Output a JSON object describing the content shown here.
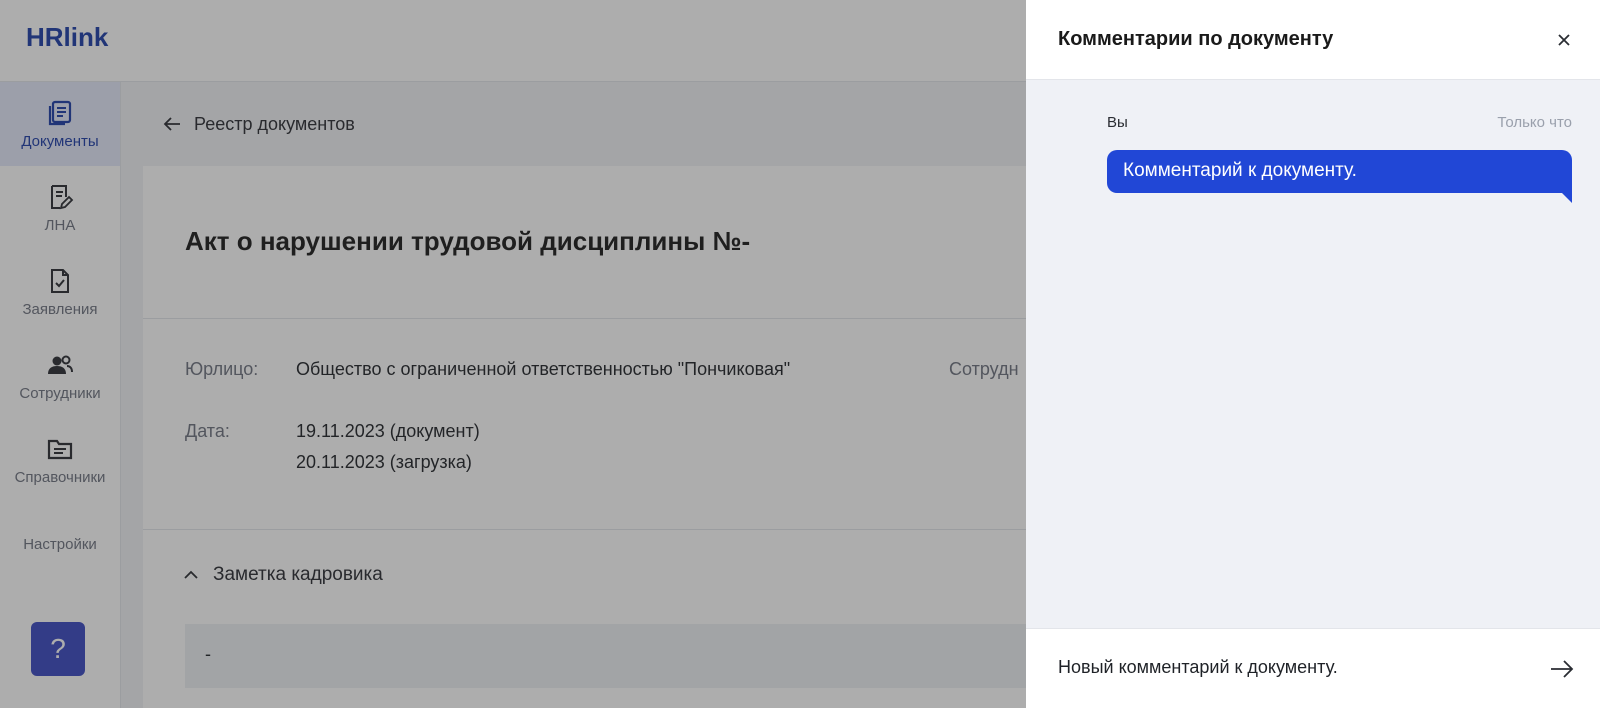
{
  "app": {
    "logo_text": "HRlink",
    "brand_color": "#1e3ea8",
    "accent_color": "#2147d6"
  },
  "sidebar": {
    "items": [
      {
        "label": "Документы",
        "icon": "documents-icon",
        "active": true
      },
      {
        "label": "ЛНА",
        "icon": "lna-document-edit-icon",
        "active": false
      },
      {
        "label": "Заявления",
        "icon": "document-check-icon",
        "active": false
      },
      {
        "label": "Сотрудники",
        "icon": "employees-icon",
        "active": false
      },
      {
        "label": "Справочники",
        "icon": "folder-icon",
        "active": false
      },
      {
        "label": "Настройки",
        "icon": "",
        "active": false
      }
    ],
    "help_label": "?"
  },
  "main": {
    "back_link": "Реестр документов",
    "title": "Акт о нарушении трудовой дисциплины №-",
    "fields": {
      "entity_label": "Юрлицо:",
      "entity_value": "Общество с ограниченной ответственностью \"Пончиковая\"",
      "employee_label": "Сотрудн",
      "date_label": "Дата:",
      "date_document": "19.11.2023 (документ)",
      "date_upload": "20.11.2023 (загрузка)"
    },
    "note": {
      "header": "Заметка кадровика",
      "content": "-"
    }
  },
  "comments_panel": {
    "title": "Комментарии по документу",
    "messages": [
      {
        "author": "Вы",
        "time": "Только что",
        "text": "Комментарий к документу."
      }
    ],
    "composer_value": "Новый комментарий к документу."
  }
}
